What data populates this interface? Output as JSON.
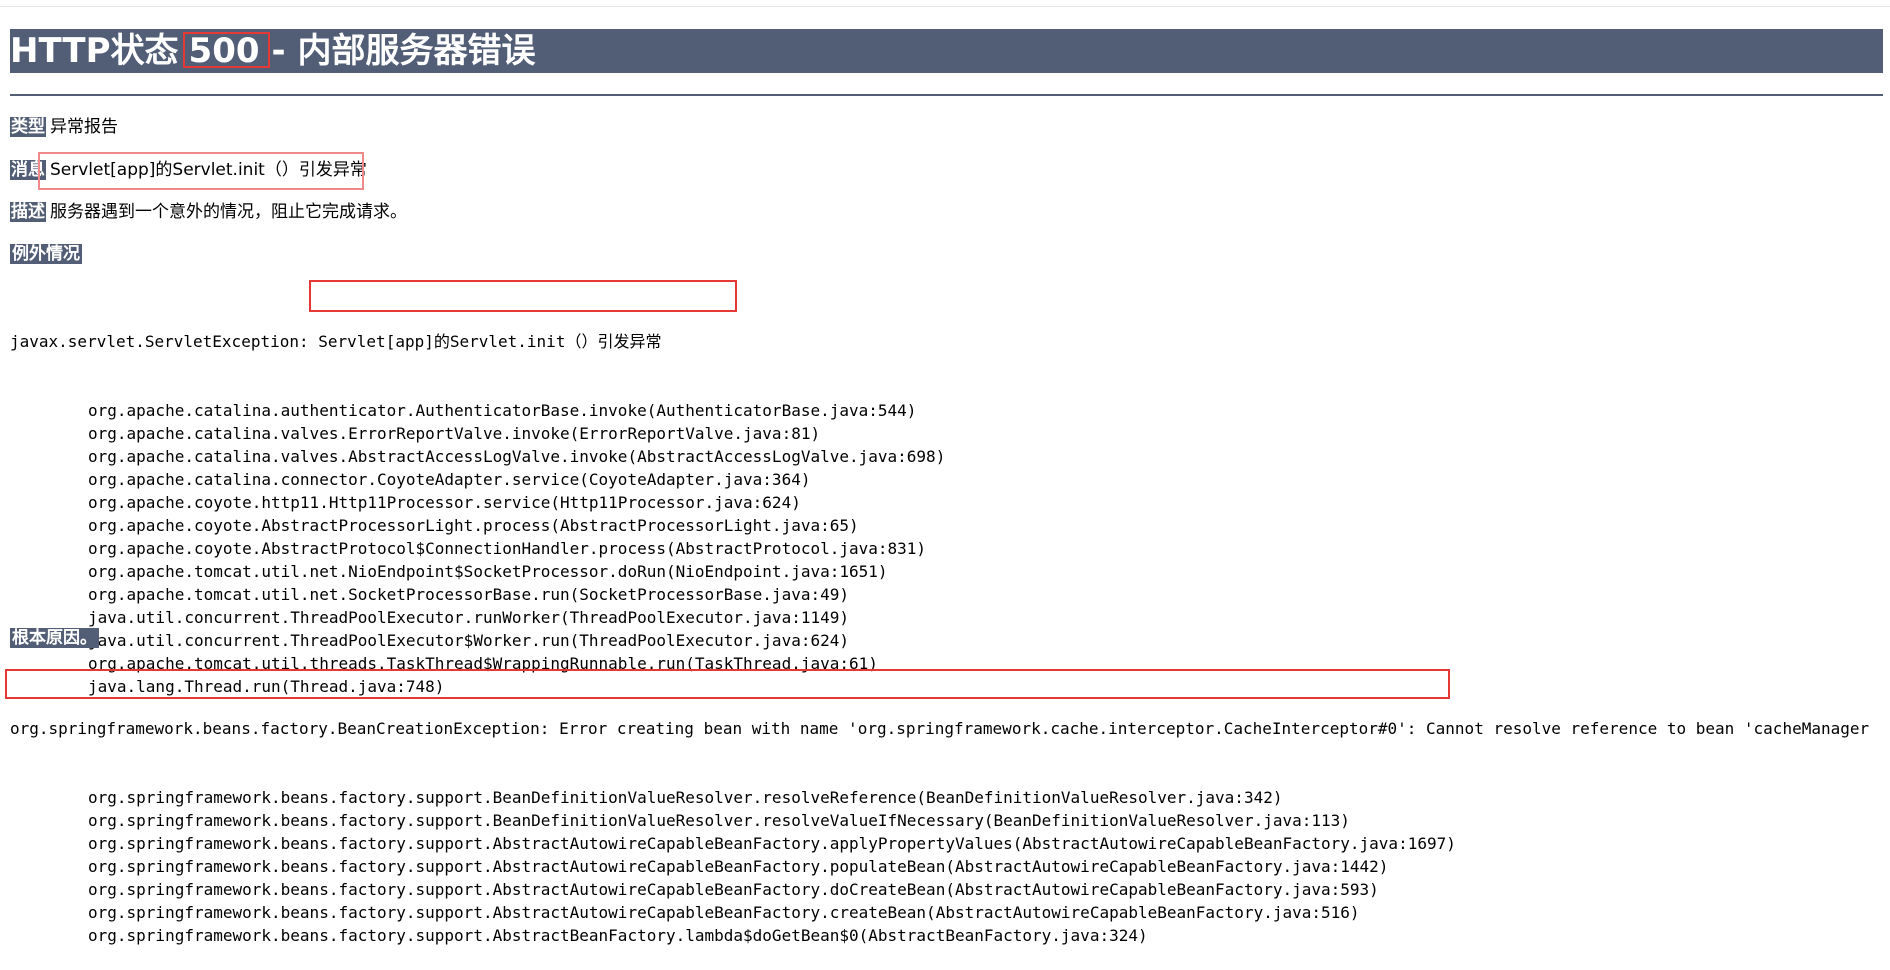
{
  "header": {
    "title_prefix": "HTTP状态",
    "status_code": "500",
    "title_suffix": "- 内部服务器错误"
  },
  "fields": {
    "type": {
      "label": "类型",
      "value": "异常报告"
    },
    "message": {
      "label": "消息",
      "value": "Servlet[app]的Servlet.init（）引发异常"
    },
    "description": {
      "label": "描述",
      "value": "服务器遇到一个意外的情况，阻止它完成请求。"
    }
  },
  "exception": {
    "heading": "例外情况",
    "first_line_prefix": "javax.servlet.ServletException:",
    "first_line_highlight": " Servlet[app]的Servlet.init（）引发异常",
    "frames": [
      "org.apache.catalina.authenticator.AuthenticatorBase.invoke(AuthenticatorBase.java:544)",
      "org.apache.catalina.valves.ErrorReportValve.invoke(ErrorReportValve.java:81)",
      "org.apache.catalina.valves.AbstractAccessLogValve.invoke(AbstractAccessLogValve.java:698)",
      "org.apache.catalina.connector.CoyoteAdapter.service(CoyoteAdapter.java:364)",
      "org.apache.coyote.http11.Http11Processor.service(Http11Processor.java:624)",
      "org.apache.coyote.AbstractProcessorLight.process(AbstractProcessorLight.java:65)",
      "org.apache.coyote.AbstractProtocol$ConnectionHandler.process(AbstractProtocol.java:831)",
      "org.apache.tomcat.util.net.NioEndpoint$SocketProcessor.doRun(NioEndpoint.java:1651)",
      "org.apache.tomcat.util.net.SocketProcessorBase.run(SocketProcessorBase.java:49)",
      "java.util.concurrent.ThreadPoolExecutor.runWorker(ThreadPoolExecutor.java:1149)",
      "java.util.concurrent.ThreadPoolExecutor$Worker.run(ThreadPoolExecutor.java:624)",
      "org.apache.tomcat.util.threads.TaskThread$WrappingRunnable.run(TaskThread.java:61)",
      "java.lang.Thread.run(Thread.java:748)"
    ]
  },
  "root_cause": {
    "heading": "根本原因。",
    "first_line_highlight": "org.springframework.beans.factory.BeanCreationException: Error creating bean with name 'org.springframework.cache.interceptor.CacheInterceptor#0':",
    "first_line_rest": " Cannot resolve reference to bean 'cacheManager",
    "frames": [
      "org.springframework.beans.factory.support.BeanDefinitionValueResolver.resolveReference(BeanDefinitionValueResolver.java:342)",
      "org.springframework.beans.factory.support.BeanDefinitionValueResolver.resolveValueIfNecessary(BeanDefinitionValueResolver.java:113)",
      "org.springframework.beans.factory.support.AbstractAutowireCapableBeanFactory.applyPropertyValues(AbstractAutowireCapableBeanFactory.java:1697)",
      "org.springframework.beans.factory.support.AbstractAutowireCapableBeanFactory.populateBean(AbstractAutowireCapableBeanFactory.java:1442)",
      "org.springframework.beans.factory.support.AbstractAutowireCapableBeanFactory.doCreateBean(AbstractAutowireCapableBeanFactory.java:593)",
      "org.springframework.beans.factory.support.AbstractAutowireCapableBeanFactory.createBean(AbstractAutowireCapableBeanFactory.java:516)",
      "org.springframework.beans.factory.support.AbstractBeanFactory.lambda$doGetBean$0(AbstractBeanFactory.java:324)"
    ]
  },
  "colors": {
    "header_bg": "#525d76",
    "highlight_border": "#e53935",
    "message_border": "#f08a8a"
  }
}
